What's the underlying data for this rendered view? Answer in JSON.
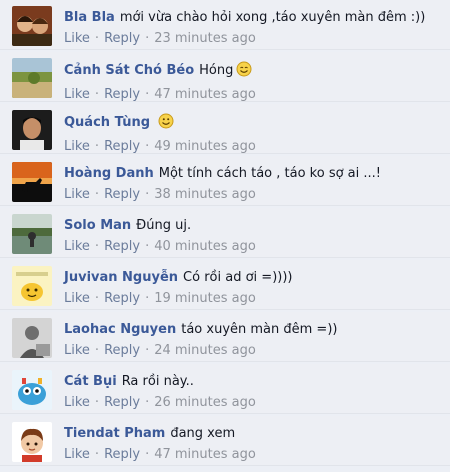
{
  "actions": {
    "like": "Like",
    "reply": "Reply",
    "separator": "·"
  },
  "comments": [
    {
      "author": "Bla Bla",
      "text": "mới vừa chào hỏi xong ,táo xuyên màn đêm :))",
      "time": "23 minutes ago",
      "avatar": "photo-kids",
      "emoji": ""
    },
    {
      "author": "Cảnh Sát Chó Béo",
      "text": "Hóng",
      "time": "47 minutes ago",
      "avatar": "photo-landscape",
      "emoji": "smile-emoji"
    },
    {
      "author": "Quách Tùng",
      "text": "",
      "time": "49 minutes ago",
      "avatar": "photo-man",
      "emoji": "smile-emoji"
    },
    {
      "author": "Hoàng Danh",
      "text": "Một tính cách táo , táo ko sợ ai ...!",
      "time": "38 minutes ago",
      "avatar": "photo-sunset-horse",
      "emoji": ""
    },
    {
      "author": "Solo Man",
      "text": "Đúng uj.",
      "time": "40 minutes ago",
      "avatar": "photo-lake",
      "emoji": ""
    },
    {
      "author": "Juvivan Nguyễn",
      "text": "Có rồi ad ơi =))))",
      "time": "19 minutes ago",
      "avatar": "cartoon-yellow",
      "emoji": ""
    },
    {
      "author": "Laohac Nguyen",
      "text": "táo xuyên màn đêm =))",
      "time": "24 minutes ago",
      "avatar": "photo-gray",
      "emoji": ""
    },
    {
      "author": "Cát Bụi",
      "text": "Ra rồi này..",
      "time": "26 minutes ago",
      "avatar": "cartoon-blue",
      "emoji": ""
    },
    {
      "author": "Tiendat Pham",
      "text": "đang xem",
      "time": "47 minutes ago",
      "avatar": "cartoon-boy",
      "emoji": ""
    }
  ],
  "colors": {
    "author": "#3b5998",
    "text": "#141823",
    "meta": "#90949c",
    "background": "#edeff4"
  }
}
